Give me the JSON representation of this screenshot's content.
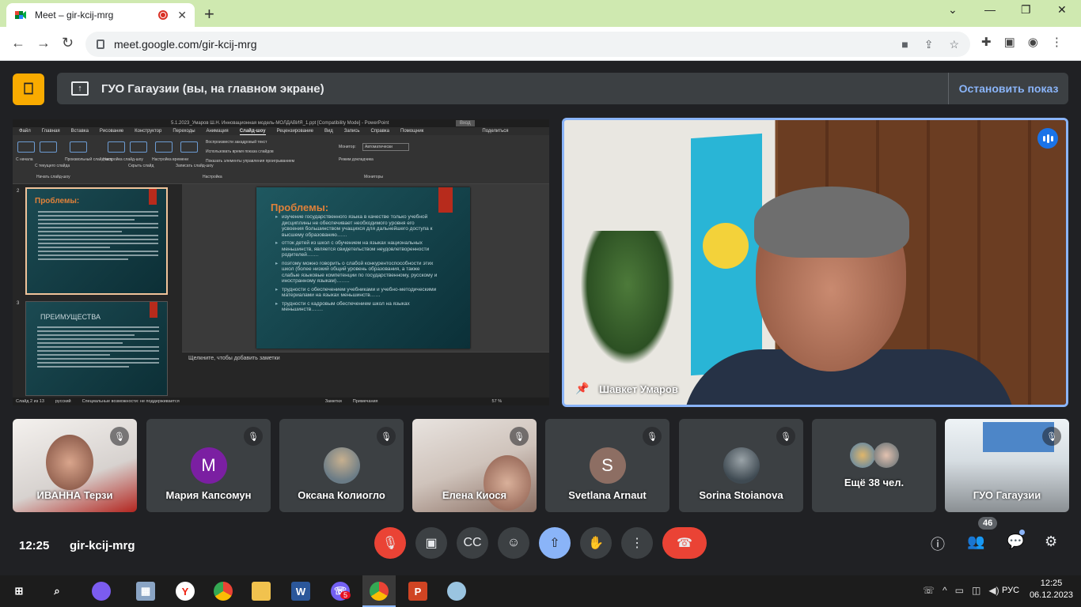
{
  "browser": {
    "tab_title": "Meet – gir-kcij-mrg",
    "close_tab": "✕",
    "new_tab": "+",
    "url": "meet.google.com/gir-kcij-mrg",
    "win_min": "⌄",
    "win_minimize": "—",
    "win_restore": "❐",
    "win_close": "✕"
  },
  "meet": {
    "presenting_title": "ГУО Гагаузии (вы, на главном экране)",
    "stop_presenting": "Остановить показ",
    "meeting_time": "12:25",
    "meeting_code": "gir-kcij-mrg",
    "participants_count": "46"
  },
  "shared_screen": {
    "window_title": "5.1.2023_Умаров Ш.Н. Инновационная модель-МОЛДАВИЯ_1.ppt [Compatibility Mode] - PowerPoint",
    "signin": "Вход",
    "menu": [
      "Файл",
      "Главная",
      "Вставка",
      "Рисование",
      "Конструктор",
      "Переходы",
      "Анимация",
      "Слайд-шоу",
      "Рецензирование",
      "Вид",
      "Запись",
      "Справка"
    ],
    "active_menu": "Слайд-шоу",
    "help_search": "Помощник",
    "share_btn": "Поделиться",
    "ribbon": {
      "from_start": "С начала",
      "from_current": "С текущего слайда",
      "custom": "Произвольный слайд-шоу",
      "group_start": "Начать слайд-шоу",
      "setup": "Настройка слайд-шоу",
      "hide": "Скрыть слайд",
      "rehearse": "Настройка времени",
      "record": "Записать слайд-шоу",
      "play_narr": "Воспроизвести закадровый текст",
      "use_timings": "Использовать время показа слайдов",
      "show_media": "Показать элементы управления проигрыванием",
      "group_setup": "Настройка",
      "monitor_label": "Монитор:",
      "monitor_value": "Автоматически",
      "presenter_view": "Режим докладчика",
      "group_monitors": "Мониторы"
    },
    "thumb2_num": "2",
    "thumb3_num": "3",
    "thumb2_title": "Проблемы:",
    "thumb3_title": "ПРЕИМУЩЕСТВА",
    "slide_title": "Проблемы:",
    "bullets": [
      "изучение государственного языка в качестве только учебной дисциплины не обеспечивает необходимого уровня его усвоения большинством учащихся для дальнейшего доступа к высшему образованию……",
      "отток детей из школ с обучением на языках национальных меньшинств, является свидетельством неудовлетворенности родителей…….",
      "поэтому можно говорить о слабой конкурентоспособности этих школ (более низкий общий уровень образования, а также слабые языковые компетенции по государственному, русскому и иностранному языкам)……..",
      "трудности с обеспечением учебниками и учебно-методическими материалами на языках меньшинств……",
      "трудности с кадровым обеспечением школ на языках меньшинств……."
    ],
    "notes": "Щелкните, чтобы добавить заметки",
    "status_slide": "Слайд 2 из 13",
    "status_lang": "русский",
    "status_access": "Специальные возможности: не поддерживается",
    "status_notes": "Заметки",
    "status_comments": "Примечания",
    "zoom": "57 %"
  },
  "speaker": {
    "name": "Шавкет Умаров"
  },
  "participants": [
    {
      "name": "ИВАННА Терзи",
      "kind": "video"
    },
    {
      "name": "Мария Капсомун",
      "kind": "letter",
      "letter": "M",
      "color": "#7b1fa2"
    },
    {
      "name": "Оксана Колиогло",
      "kind": "photo"
    },
    {
      "name": "Елена Киося",
      "kind": "video"
    },
    {
      "name": "Svetlana Arnaut",
      "kind": "letter",
      "letter": "S",
      "color": "#8d6e63"
    },
    {
      "name": "Sorina Stoianova",
      "kind": "photo"
    },
    {
      "name": "Ещё 38 чел.",
      "kind": "more"
    },
    {
      "name": "ГУО Гагаузии",
      "kind": "video"
    }
  ],
  "taskbar": {
    "time": "12:25",
    "date": "06.12.2023",
    "lang": "РУС",
    "viber_badge": "5"
  },
  "icons": {
    "mic_off": "mic-off-icon",
    "camera": "camera-icon",
    "captions": "captions-icon",
    "emoji": "emoji-icon",
    "present": "present-icon",
    "hand": "raise-hand-icon",
    "more": "more-options-icon",
    "end_call": "end-call-icon"
  }
}
